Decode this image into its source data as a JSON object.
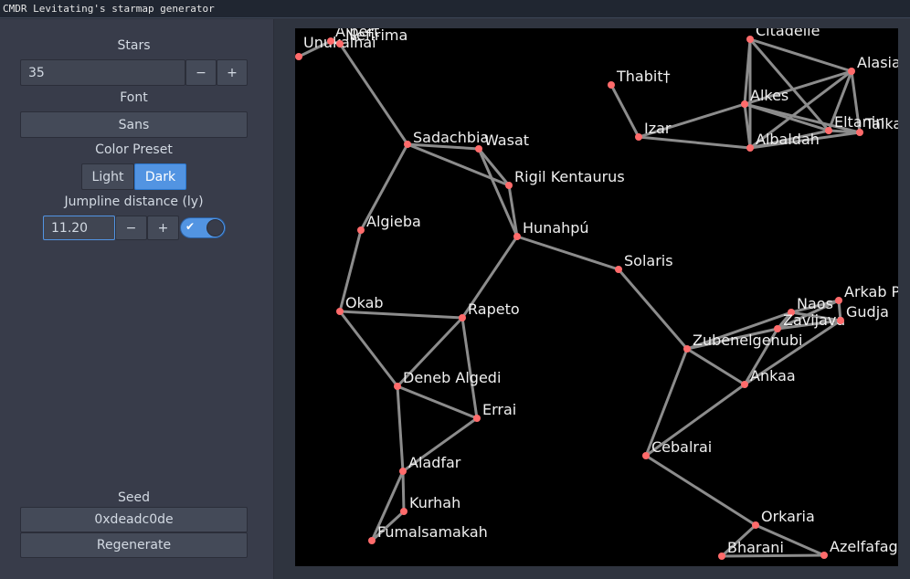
{
  "window": {
    "title": "CMDR Levitating's starmap generator"
  },
  "sidebar": {
    "stars_label": "Stars",
    "stars_value": "35",
    "minus": "−",
    "plus": "+",
    "font_label": "Font",
    "font_value": "Sans",
    "color_preset_label": "Color Preset",
    "preset_light": "Light",
    "preset_dark": "Dark",
    "preset_selected": "Dark",
    "jump_label": "Jumpline distance (ly)",
    "jump_value": "11.20",
    "jump_toggle_on": true,
    "seed_label": "Seed",
    "seed_value": "0xdeadc0de",
    "regenerate": "Regenerate"
  },
  "colors": {
    "accent": "#5294e2",
    "star": "#ff6b6b",
    "line": "#8c8c8c",
    "map_bg": "#000000"
  },
  "starmap": {
    "stars": [
      {
        "name": "Unukalhai"
      },
      {
        "name": "Alpert"
      },
      {
        "name": "Nefirima"
      },
      {
        "name": "Sadachbia"
      },
      {
        "name": "Wasat"
      },
      {
        "name": "Rigil Kentaurus"
      },
      {
        "name": "Hunahpú"
      },
      {
        "name": "Algieba"
      },
      {
        "name": "Okab"
      },
      {
        "name": "Rapeto"
      },
      {
        "name": "Deneb Algedi"
      },
      {
        "name": "Errai"
      },
      {
        "name": "Aladfar"
      },
      {
        "name": "Kurhah"
      },
      {
        "name": "Fumalsamakah"
      },
      {
        "name": "Solaris"
      },
      {
        "name": "Thabit†"
      },
      {
        "name": "Izar"
      },
      {
        "name": "Citadelle"
      },
      {
        "name": "Alasia"
      },
      {
        "name": "Alkes"
      },
      {
        "name": "Albaldah"
      },
      {
        "name": "Eltanin"
      },
      {
        "name": "Taika"
      },
      {
        "name": "Zubenelgenubi"
      },
      {
        "name": "Naos"
      },
      {
        "name": "Zavijava"
      },
      {
        "name": "Arkab P"
      },
      {
        "name": "Gudja"
      },
      {
        "name": "Ankaa"
      },
      {
        "name": "Cebalrai"
      },
      {
        "name": "Orkaria"
      },
      {
        "name": "Bharani"
      },
      {
        "name": "Azelfafage"
      }
    ]
  }
}
